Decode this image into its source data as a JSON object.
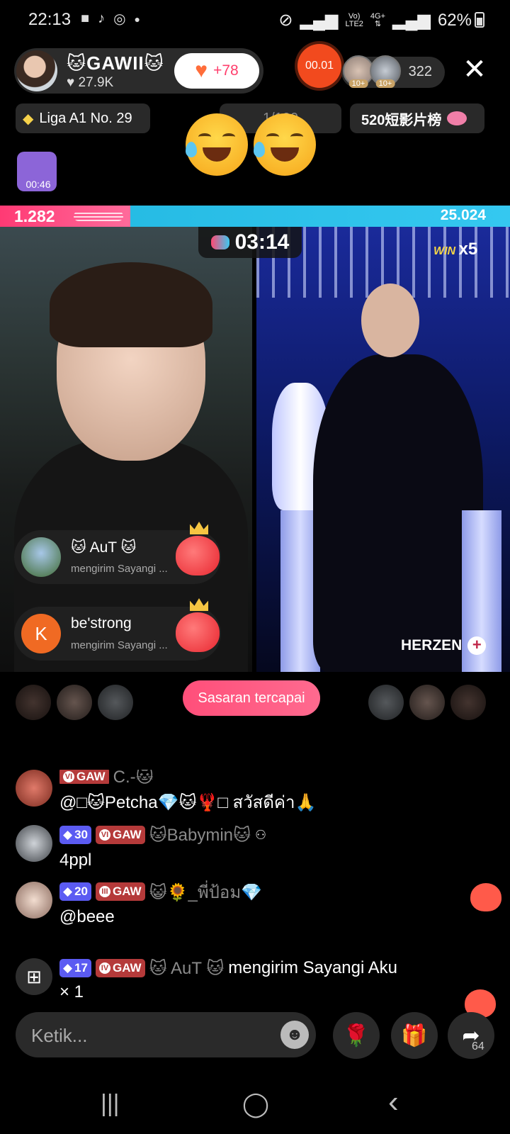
{
  "status_bar": {
    "time": "22:13",
    "net_top": "Vo)",
    "net_bottom": "LTE2",
    "data_top": "4G+",
    "battery": "62%"
  },
  "host": {
    "name": "🐱GAWII🐱",
    "likes": "♥ 27.9K",
    "follow_heart": "♥",
    "follow_count": "+78"
  },
  "top_right": {
    "timer": "00.01",
    "badge1": "10+",
    "badge2": "10+",
    "viewer_count": "322",
    "close_icon": "✕"
  },
  "tags": {
    "league": "Liga A1 No. 29",
    "rank": "1/100",
    "chart": "520短影片榜"
  },
  "gift_thumb": {
    "time": "00:46"
  },
  "battle": {
    "left_score": "1.282",
    "right_score": "25.024",
    "timer": "03:14",
    "win_label": "WIN",
    "win_streak": "x5"
  },
  "opponent": {
    "name": "HERZEN",
    "plus": "+"
  },
  "gift_popups": [
    {
      "name": "🐱 AuT 🐱",
      "sub": "mengirim Sayangi ...",
      "avatar_letter": ""
    },
    {
      "name": "be'strong",
      "sub": "mengirim Sayangi ...",
      "avatar_letter": "K"
    }
  ],
  "target_button": "Sasaran tercapai",
  "chat": [
    {
      "level": "",
      "gaw_tier": "VI",
      "gaw": "GAW",
      "name": "C.-🐱",
      "message": "@□🐱Petcha💎🐱🦞□ สวัสดีค่า🙏"
    },
    {
      "level": "30",
      "gaw_tier": "VI",
      "gaw": "GAW",
      "name": "🐱Babymin🐱",
      "message": "4ppl"
    },
    {
      "level": "20",
      "gaw_tier": "III",
      "gaw": "GAW",
      "name": "😺🌻_พี่ป้อม💎",
      "message": "@beee"
    },
    {
      "level": "17",
      "gaw_tier": "IV",
      "gaw": "GAW",
      "name": "🐱 AuT 🐱",
      "message_inline": "mengirim Sayangi Aku",
      "message": "× 1"
    }
  ],
  "input": {
    "placeholder": "Ketik...",
    "smiley": "☻",
    "rose": "🌹",
    "gift": "🎁",
    "share": "➦",
    "share_count": "64"
  },
  "nav": {
    "recents": "|||",
    "home": "◯",
    "back": "‹"
  },
  "icons": {
    "camera": "video-camera-icon",
    "tiktok": "tiktok-icon",
    "instagram": "instagram-icon",
    "mute": "mute-icon",
    "signal": "signal-icon",
    "battery": "battery-icon"
  },
  "colors": {
    "accent_pink": "#ff4f7a",
    "accent_blue": "#35c8f0",
    "live_orange": "#f24a1e"
  }
}
